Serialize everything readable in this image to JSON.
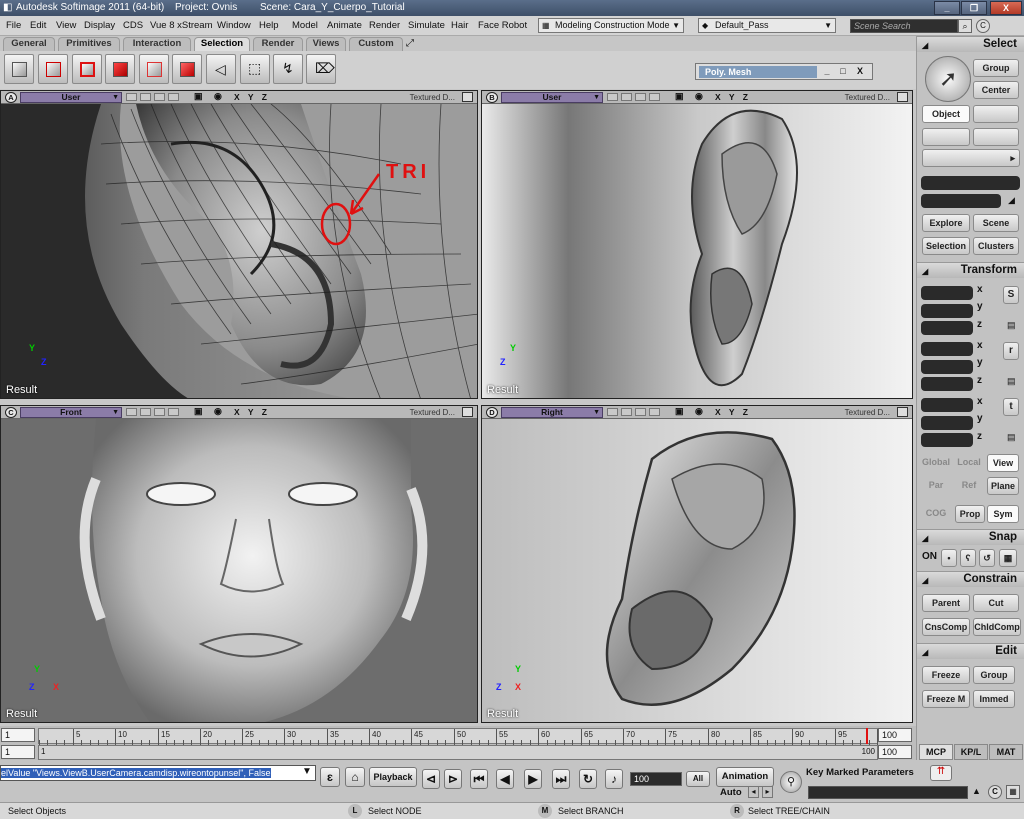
{
  "titlebar": {
    "app": "Autodesk Softimage 2011 (64-bit)",
    "project": "Project: Ovnis",
    "scene": "Scene: Cara_Y_Cuerpo_Tutorial"
  },
  "menu": [
    "File",
    "Edit",
    "View",
    "Display",
    "CDS",
    "Vue 8 xStream",
    "Window",
    "Help",
    "Model",
    "Animate",
    "Render",
    "Simulate",
    "Hair",
    "Face Robot"
  ],
  "mode_dropdown": "Modeling Construction Mode",
  "pass_dropdown": "Default_Pass",
  "search_placeholder": "Scene Search",
  "tabs": [
    "General",
    "Primitives",
    "Interaction",
    "Selection",
    "Render",
    "Views",
    "Custom"
  ],
  "polymesh": {
    "label": "Poly. Mesh",
    "close": "X"
  },
  "viewports": {
    "a": {
      "letter": "A",
      "camera": "User",
      "display": "Textured D..."
    },
    "b": {
      "letter": "B",
      "camera": "User",
      "display": "Textured D..."
    },
    "c": {
      "letter": "C",
      "camera": "Front",
      "display": "Textured D..."
    },
    "d": {
      "letter": "D",
      "camera": "Right",
      "display": "Textured D..."
    },
    "xyz": "X Y Z",
    "result_label": "Result",
    "annotation": "TRI"
  },
  "right_panel": {
    "select_title": "Select",
    "group": "Group",
    "center": "Center",
    "object": "Object",
    "explore": "Explore",
    "scene": "Scene",
    "selection": "Selection",
    "clusters": "Clusters",
    "transform_title": "Transform",
    "axis_x": "x",
    "axis_y": "y",
    "axis_z": "z",
    "s_icon": "S",
    "r_icon": "r",
    "t_icon": "t",
    "global": "Global",
    "local": "Local",
    "view": "View",
    "par": "Par",
    "ref": "Ref",
    "plane": "Plane",
    "cog": "COG",
    "prop": "Prop",
    "sym": "Sym",
    "snap_title": "Snap",
    "on": "ON",
    "constrain_title": "Constrain",
    "parent": "Parent",
    "cut": "Cut",
    "cnscomp": "CnsComp",
    "chldcomp": "ChldComp",
    "edit_title": "Edit",
    "freeze": "Freeze",
    "group2": "Group",
    "freeze_m": "Freeze M",
    "immed": "Immed",
    "bottom_tabs": [
      "MCP",
      "KP/L",
      "MAT"
    ]
  },
  "timeline": {
    "start": "1",
    "end": "100",
    "current": "1",
    "range_start": "1",
    "range_end": "100",
    "range_end2": "100",
    "current_frame": "1",
    "ticks": [
      "5",
      "10",
      "15",
      "20",
      "25",
      "30",
      "35",
      "40",
      "45",
      "50",
      "55",
      "60",
      "65",
      "70",
      "75",
      "80",
      "85",
      "90",
      "95"
    ]
  },
  "command_line": {
    "highlight": "elValue \"Views.ViewB.UserCamera.camdisp.wireontopunsel\", False"
  },
  "playback": {
    "label": "Playback",
    "frame": "100",
    "all": "All",
    "animation": "Animation",
    "auto": "Auto",
    "key_marked": "Key Marked Parameters"
  },
  "status": {
    "left": "Select Objects",
    "l": "L",
    "l_text": "Select NODE",
    "m": "M",
    "m_text": "Select BRANCH",
    "r": "R",
    "r_text": "Select TREE/CHAIN"
  },
  "colors": {
    "accent_blue": "#2f5fb8",
    "camera_purple": "#8b7ca8",
    "annotation_red": "#e01010"
  }
}
